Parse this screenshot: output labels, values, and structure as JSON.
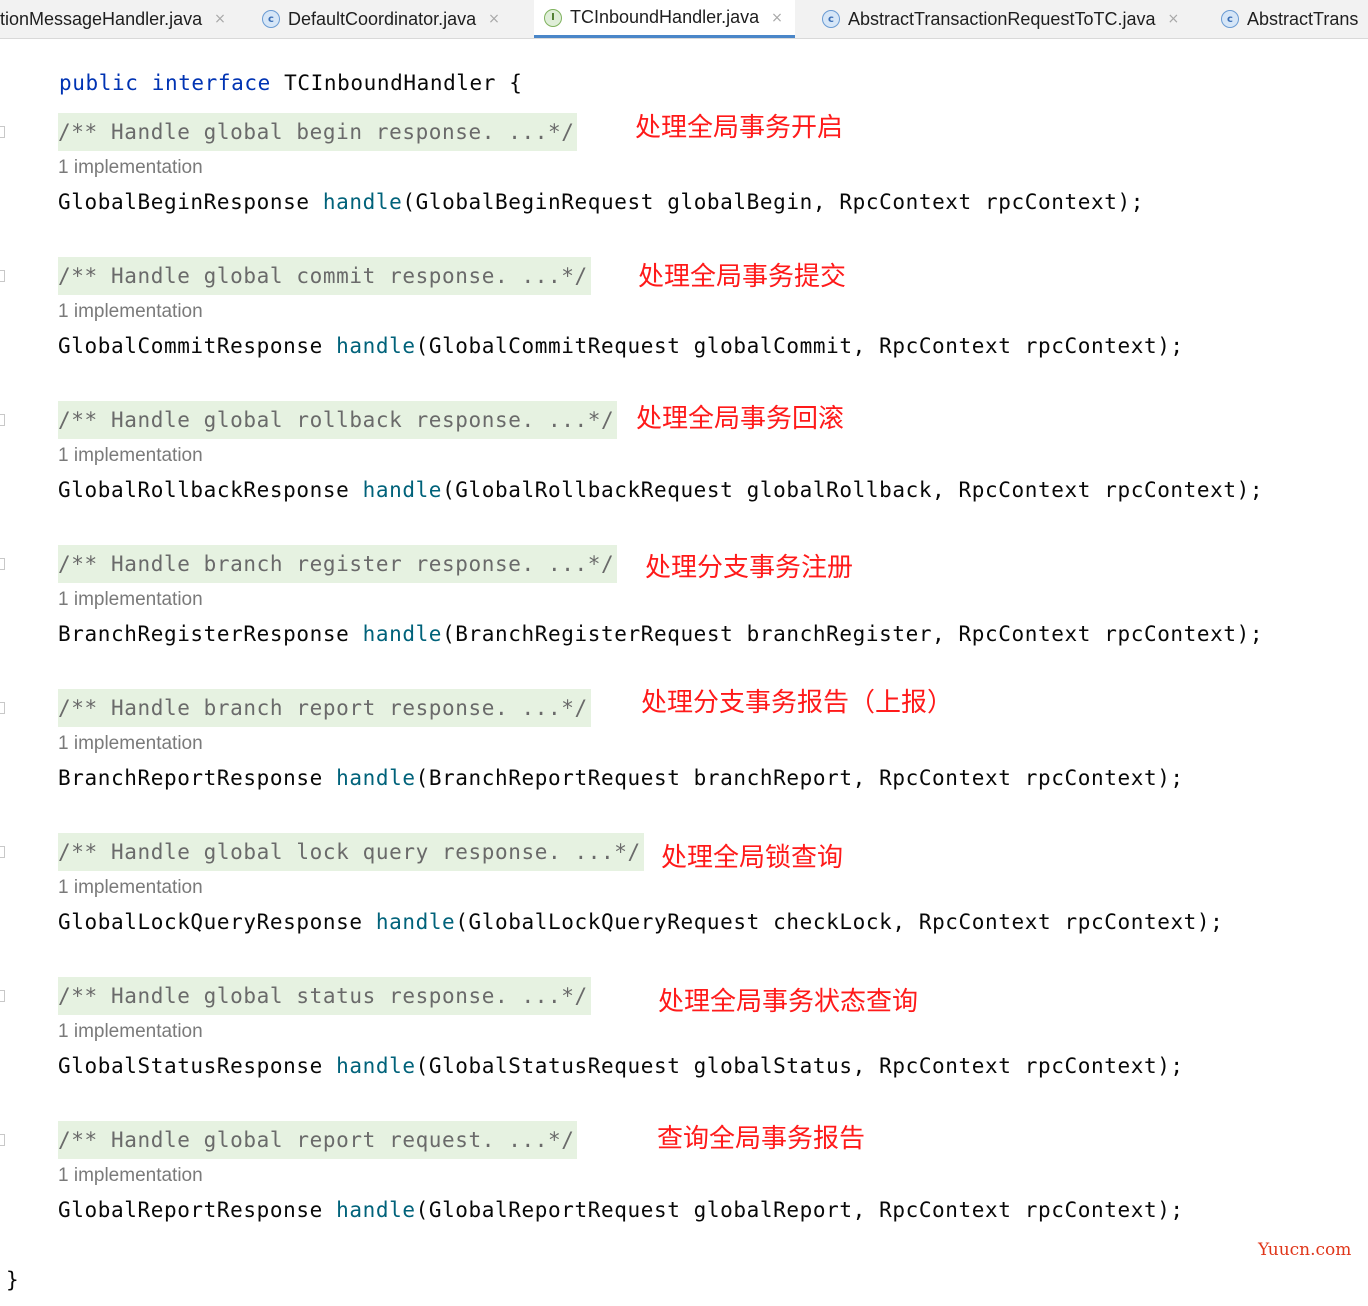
{
  "tabs": [
    {
      "label": "tionMessageHandler.java",
      "icon": "none"
    },
    {
      "label": "DefaultCoordinator.java",
      "icon": "class-icon"
    },
    {
      "label": "TCInboundHandler.java",
      "icon": "interface-icon"
    },
    {
      "label": "AbstractTransactionRequestToTC.java",
      "icon": "class-icon"
    },
    {
      "label": "AbstractTrans",
      "icon": "class-icon"
    }
  ],
  "icon_letters": {
    "class": "c",
    "interface": "I"
  },
  "close_glyph": "×",
  "code": {
    "kw_public": "public",
    "kw_interface": "interface",
    "header_rest": " TCInboundHandler {",
    "closing_brace": "}",
    "impl_label": "1 implementation",
    "method_name": "handle",
    "methods": [
      {
        "doc": "/** Handle global begin response. ...*/",
        "return_type": "GlobalBeginResponse ",
        "params": "(GlobalBeginRequest globalBegin, RpcContext rpcContext);",
        "note": "处理全局事务开启"
      },
      {
        "doc": "/** Handle global commit response. ...*/",
        "return_type": "GlobalCommitResponse ",
        "params": "(GlobalCommitRequest globalCommit, RpcContext rpcContext);",
        "note": "处理全局事务提交"
      },
      {
        "doc": "/** Handle global rollback response. ...*/",
        "return_type": "GlobalRollbackResponse ",
        "params": "(GlobalRollbackRequest globalRollback, RpcContext rpcContext);",
        "note": "处理全局事务回滚"
      },
      {
        "doc": "/** Handle branch register response. ...*/",
        "return_type": "BranchRegisterResponse ",
        "params": "(BranchRegisterRequest branchRegister, RpcContext rpcContext);",
        "note": "处理分支事务注册"
      },
      {
        "doc": "/** Handle branch report response. ...*/",
        "return_type": "BranchReportResponse ",
        "params": "(BranchReportRequest branchReport, RpcContext rpcContext);",
        "note": "处理分支事务报告（上报）"
      },
      {
        "doc": "/** Handle global lock query response. ...*/",
        "return_type": "GlobalLockQueryResponse ",
        "params": "(GlobalLockQueryRequest checkLock, RpcContext rpcContext);",
        "note": "处理全局锁查询"
      },
      {
        "doc": "/** Handle global status response. ...*/",
        "return_type": "GlobalStatusResponse ",
        "params": "(GlobalStatusRequest globalStatus, RpcContext rpcContext);",
        "note": "处理全局事务状态查询"
      },
      {
        "doc": "/** Handle global report request. ...*/",
        "return_type": "GlobalReportResponse ",
        "params": "(GlobalReportRequest globalReport, RpcContext rpcContext);",
        "note": "查询全局事务报告"
      }
    ]
  },
  "watermark": "Yuucn.com"
}
